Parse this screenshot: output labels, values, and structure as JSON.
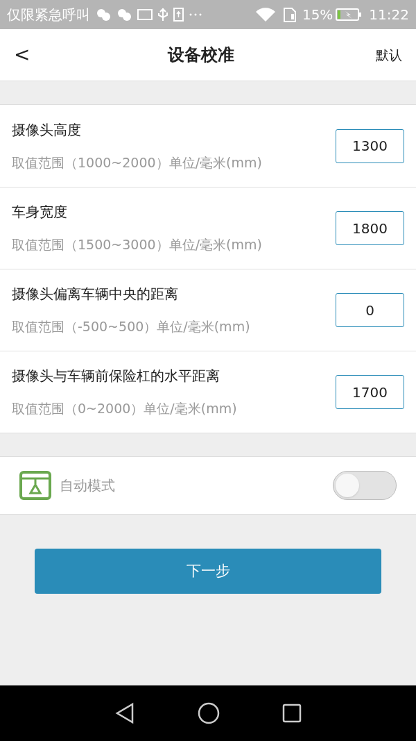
{
  "status_bar": {
    "carrier": "仅限紧急呼叫",
    "battery": "15%",
    "time": "11:22"
  },
  "header": {
    "back": "<",
    "title": "设备校准",
    "action": "默认"
  },
  "fields": [
    {
      "label": "摄像头高度",
      "hint": "取值范围（1000~2000）单位/毫米(mm)",
      "value": "1300"
    },
    {
      "label": "车身宽度",
      "hint": "取值范围（1500~3000）单位/毫米(mm)",
      "value": "1800"
    },
    {
      "label": "摄像头偏离车辆中央的距离",
      "hint": "取值范围（-500~500）单位/毫米(mm)",
      "value": "0"
    },
    {
      "label": "摄像头与车辆前保险杠的水平距离",
      "hint": "取值范围（0~2000）单位/毫米(mm)",
      "value": "1700"
    }
  ],
  "auto_mode": {
    "label": "自动模式",
    "on": false
  },
  "next_button": "下一步"
}
